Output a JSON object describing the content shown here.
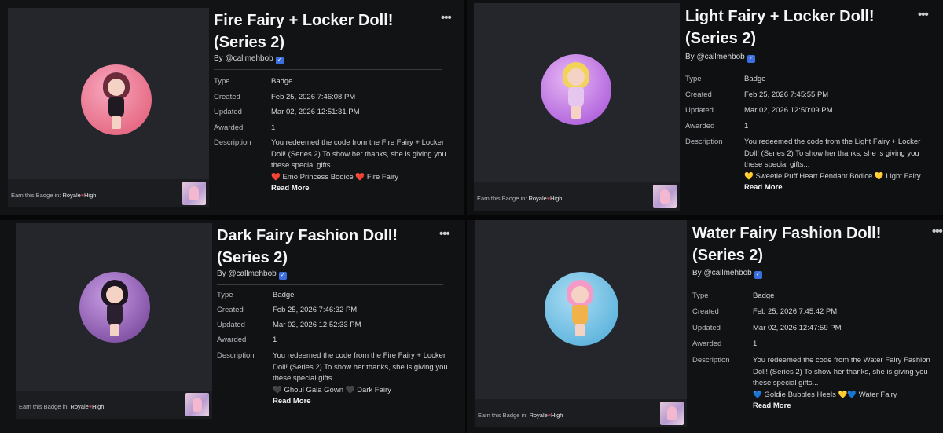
{
  "common": {
    "author": "By @callmehbob",
    "more_glyph": "•••",
    "verified_glyph": "✓",
    "earn_prefix": "Earn this Badge in:",
    "game_name_left": "Royale",
    "game_heart": "♥",
    "game_name_right": "High",
    "labels": {
      "type": "Type",
      "created": "Created",
      "updated": "Updated",
      "awarded": "Awarded",
      "description": "Description"
    },
    "read_more": "Read More"
  },
  "cards": [
    {
      "title_line1": "Fire Fairy + Locker Doll!",
      "title_line2": "(Series 2)",
      "type": "Badge",
      "created": "Feb 25, 2026 7:46:08 PM",
      "updated": "Mar 02, 2026 12:51:31 PM",
      "awarded": "1",
      "desc_line1": "You redeemed the code from the Fire Fairy + Locker",
      "desc_line2": "Doll! (Series 2) To show her thanks, she is giving you",
      "desc_line3": "these special gifts...",
      "gifts": "❤️ Emo Princess Bodice ❤️ Fire Fairy",
      "badge_colors": {
        "bg1": "#f7a7bf",
        "bg2": "#e0566f",
        "hair": "#6b2b3b",
        "body": "#1f1a22"
      }
    },
    {
      "title_line1": "Light Fairy + Locker Doll!",
      "title_line2": "(Series 2)",
      "type": "Badge",
      "created": "Feb 25, 2026 7:45:55 PM",
      "updated": "Mar 02, 2026 12:50:09 PM",
      "awarded": "1",
      "desc_line1": "You redeemed the code from the Light Fairy + Locker",
      "desc_line2": "Doll! (Series 2) To show her thanks, she is giving you",
      "desc_line3": "these special gifts...",
      "gifts": "💛 Sweetie Puff Heart Pendant Bodice 💛 Light Fairy",
      "badge_colors": {
        "bg1": "#e7b8f4",
        "bg2": "#a24bd6",
        "hair": "#f2d45a",
        "body": "#e6c6ef"
      }
    },
    {
      "title_line1": "Dark Fairy Fashion Doll!",
      "title_line2": "(Series 2)",
      "type": "Badge",
      "created": "Feb 25, 2026 7:46:32 PM",
      "updated": "Mar 02, 2026 12:52:33 PM",
      "awarded": "1",
      "desc_line1": "You redeemed the code from the Fire Fairy + Locker",
      "desc_line2": "Doll! (Series 2) To show her thanks, she is giving you",
      "desc_line3": "these special gifts...",
      "gifts": "🖤 Ghoul Gala Gown 🖤 Dark Fairy",
      "badge_colors": {
        "bg1": "#c79be3",
        "bg2": "#6c3b92",
        "hair": "#1e1620",
        "body": "#2a2030"
      }
    },
    {
      "title_line1": "Water Fairy Fashion Doll!",
      "title_line2": "(Series 2)",
      "type": "Badge",
      "created": "Feb 25, 2026 7:45:42 PM",
      "updated": "Mar 02, 2026 12:47:59 PM",
      "awarded": "1",
      "desc_line1": "You redeemed the code from the Water Fairy Fashion",
      "desc_line2": "Doll! (Series 2) To show her thanks, she is giving you",
      "desc_line3": "these special gifts...",
      "gifts": "💙 Goldie Bubbles Heels 💛💙 Water Fairy",
      "badge_colors": {
        "bg1": "#a9dcf2",
        "bg2": "#4aa9d8",
        "hair": "#f59ac6",
        "body": "#f2b24a"
      }
    }
  ]
}
